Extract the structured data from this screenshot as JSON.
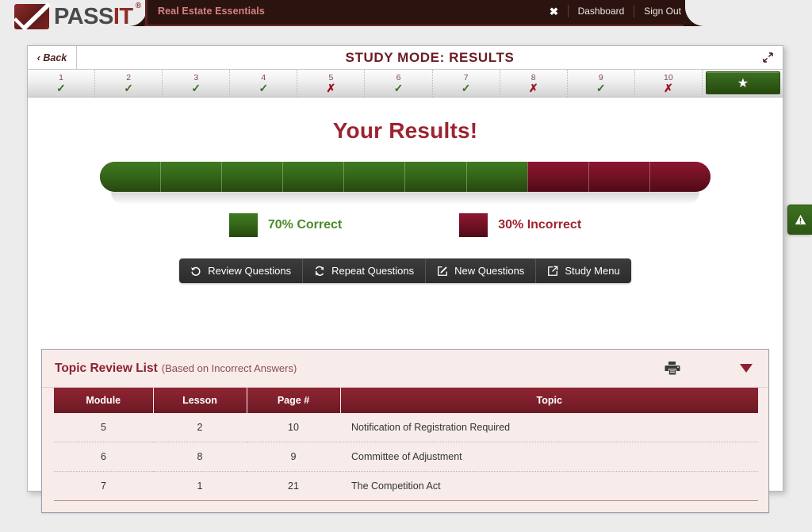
{
  "header": {
    "brand_text": "PASS",
    "brand_text_accent": "IT",
    "brand_registered": "®",
    "product_title": "Real Estate Essentials",
    "fullscreen_icon": "fullscreen-icon",
    "dashboard_label": "Dashboard",
    "signout_label": "Sign Out",
    "accent_color": "#2b1410",
    "product_title_color": "#d9827e"
  },
  "titlebar": {
    "back_label": "‹ Back",
    "title": "STUDY MODE: RESULTS",
    "expand_icon": "expand-diagonal-icon",
    "title_color": "#6b1d22"
  },
  "question_strip": {
    "questions": [
      {
        "number": "1",
        "mark": "✓",
        "status": "correct"
      },
      {
        "number": "2",
        "mark": "✓",
        "status": "correct"
      },
      {
        "number": "3",
        "mark": "✓",
        "status": "correct"
      },
      {
        "number": "4",
        "mark": "✓",
        "status": "correct"
      },
      {
        "number": "5",
        "mark": "✗",
        "status": "incorrect"
      },
      {
        "number": "6",
        "mark": "✓",
        "status": "correct"
      },
      {
        "number": "7",
        "mark": "✓",
        "status": "correct"
      },
      {
        "number": "8",
        "mark": "✗",
        "status": "incorrect"
      },
      {
        "number": "9",
        "mark": "✓",
        "status": "correct"
      },
      {
        "number": "10",
        "mark": "✗",
        "status": "incorrect"
      }
    ],
    "star_icon": "★",
    "star_button_color": "#356819"
  },
  "results": {
    "title": "Your Results!",
    "title_color": "#9c2430"
  },
  "chart_data": {
    "type": "bar",
    "title": "Your Results!",
    "orientation": "horizontal-stacked",
    "categories": [
      "Correct",
      "Incorrect"
    ],
    "values": [
      70,
      30
    ],
    "unit": "%",
    "segments": 10,
    "colors": [
      "#356819",
      "#751225"
    ],
    "legend": [
      {
        "label": "70% Correct",
        "value": 70,
        "color": "#4b8a28",
        "swatch": "#356819"
      },
      {
        "label": "30% Incorrect",
        "value": 30,
        "color": "#9c2430",
        "swatch": "#751225"
      }
    ],
    "legend_position": "bottom",
    "grid": false,
    "xlabel": "",
    "ylabel": "",
    "xlim": [
      0,
      100
    ]
  },
  "actions": {
    "buttons": [
      {
        "label": "Review Questions",
        "icon": "undo-history-icon"
      },
      {
        "label": "Repeat Questions",
        "icon": "refresh-icon"
      },
      {
        "label": "New Questions",
        "icon": "pencil-square-icon"
      },
      {
        "label": "Study Menu",
        "icon": "external-link-icon"
      }
    ]
  },
  "topic_review": {
    "title": "Topic Review List",
    "subtitle": "(Based on Incorrect Answers)",
    "print_icon": "printer-icon",
    "collapse_icon": "caret-down-icon",
    "columns": [
      "Module",
      "Lesson",
      "Page #",
      "Topic"
    ],
    "rows": [
      {
        "module": "5",
        "lesson": "2",
        "page": "10",
        "topic": "Notification of Registration Required"
      },
      {
        "module": "6",
        "lesson": "8",
        "page": "9",
        "topic": "Committee of Adjustment"
      },
      {
        "module": "7",
        "lesson": "1",
        "page": "21",
        "topic": "The Competition Act"
      }
    ],
    "header_color": "#7d1f2b",
    "background_color": "#f7ecea"
  },
  "feedback_tab": {
    "icon": "warning-triangle-icon",
    "color": "#356819"
  }
}
